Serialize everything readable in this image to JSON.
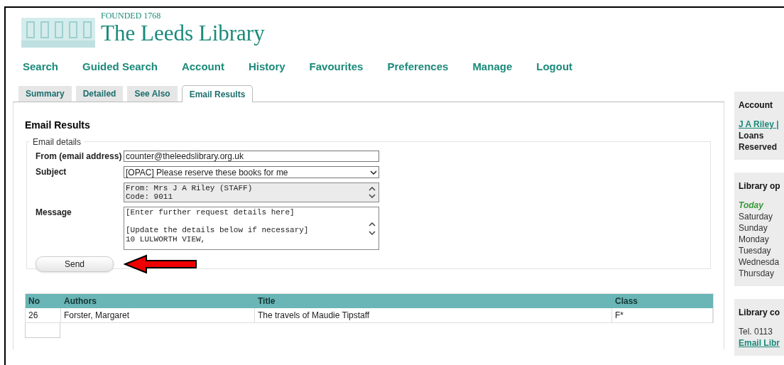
{
  "header": {
    "founded": "FOUNDED 1768",
    "title": "The Leeds Library"
  },
  "nav": [
    "Search",
    "Guided Search",
    "Account",
    "History",
    "Favourites",
    "Preferences",
    "Manage",
    "Logout"
  ],
  "tabs": [
    {
      "label": "Summary",
      "selected": false
    },
    {
      "label": "Detailed",
      "selected": false
    },
    {
      "label": "See Also",
      "selected": false
    },
    {
      "label": "Email Results",
      "selected": true
    }
  ],
  "panel": {
    "heading": "Email Results",
    "legend": "Email details",
    "from": {
      "label": "From (email address)",
      "value": "counter@theleedslibrary.org.uk"
    },
    "subject": {
      "label": "Subject",
      "value": "[OPAC] Please reserve these books for me"
    },
    "info": [
      "From: Mrs J A Riley (STAFF)",
      "Code: 9011"
    ],
    "message": {
      "label": "Message",
      "paragraphs": [
        [
          "[Enter further request details here]"
        ],
        [
          "[Update the details below if necessary]",
          "10 LULWORTH VIEW,"
        ]
      ]
    },
    "send": "Send"
  },
  "table": {
    "columns": [
      "No",
      "Authors",
      "Title",
      "Class"
    ],
    "rows": [
      [
        "26",
        "Forster, Margaret",
        "The travels of Maudie Tipstaff",
        "F*"
      ]
    ]
  },
  "sidebar": [
    {
      "title": "Account",
      "items": [
        {
          "text": "J A Riley |",
          "kind": "link"
        },
        {
          "text": "Loans",
          "kind": "bold"
        },
        {
          "text": "Reserved",
          "kind": "bold"
        }
      ]
    },
    {
      "title": "Library op",
      "items": [
        {
          "text": "Today",
          "kind": "today"
        },
        {
          "text": "Saturday",
          "kind": "plain"
        },
        {
          "text": "Sunday",
          "kind": "plain"
        },
        {
          "text": "Monday",
          "kind": "plain"
        },
        {
          "text": "Tuesday",
          "kind": "plain"
        },
        {
          "text": "Wednesda",
          "kind": "plain"
        },
        {
          "text": "Thursday",
          "kind": "plain"
        }
      ]
    },
    {
      "title": "Library co",
      "items": [
        {
          "text": "Tel. 0113",
          "kind": "plain"
        },
        {
          "text": "Email Libr",
          "kind": "link"
        }
      ]
    }
  ]
}
